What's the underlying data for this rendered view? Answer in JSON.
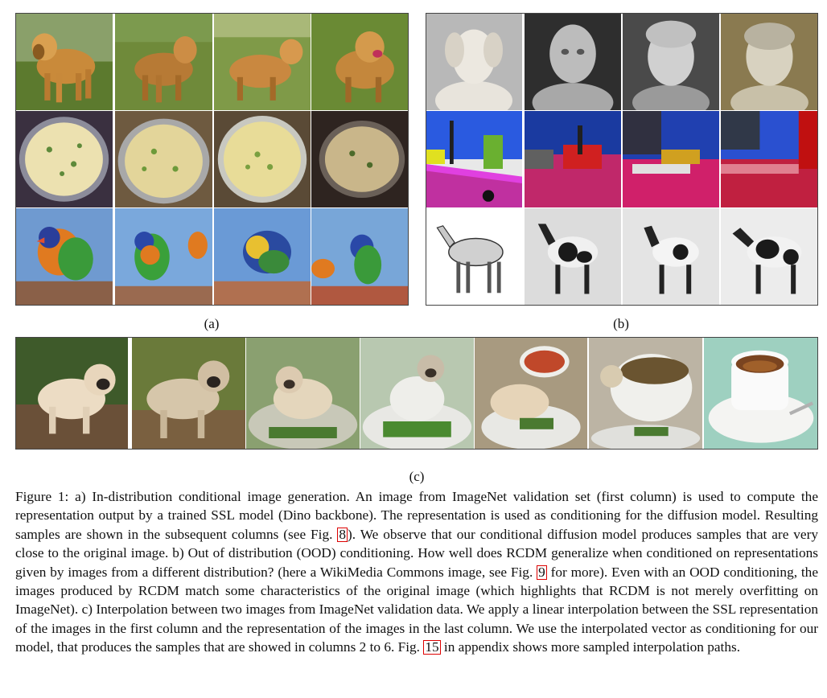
{
  "panels": {
    "a_label": "(a)",
    "b_label": "(b)",
    "c_label": "(c)",
    "a_rows": [
      [
        "golden-retriever",
        "golden-retriever",
        "golden-retriever",
        "golden-retriever"
      ],
      [
        "pasta-salad-bowl",
        "pasta-salad-bowl",
        "pasta-salad-bowl",
        "pasta-salad-bowl"
      ],
      [
        "rainbow-lorikeet",
        "rainbow-lorikeet",
        "rainbow-lorikeet",
        "rainbow-lorikeet"
      ]
    ],
    "b_rows": [
      [
        "marble-bust",
        "marble-bust",
        "marble-bust",
        "marble-bust"
      ],
      [
        "segmentation-map",
        "segmentation-map",
        "segmentation-map",
        "segmentation-map"
      ],
      [
        "horse-sketch",
        "horse-sketch",
        "horse-sketch",
        "horse-sketch"
      ]
    ],
    "c_row": [
      "pug",
      "pug",
      "pug-in-bowl",
      "pug-cup",
      "cup-pug",
      "coffee-cup",
      "espresso-cup"
    ]
  },
  "caption": {
    "p1": "Figure 1: a) In-distribution conditional image generation. An image from ImageNet validation set (first column) is used to compute the representation output by a trained SSL model (Dino backbone). The representation is used as conditioning for the diffusion model. Resulting samples are shown in the subsequent columns (see Fig. ",
    "ref1": "8",
    "p2": "). We observe that our conditional diffusion model produces samples that are very close to the original image. b) Out of distribution (OOD) conditioning. How well does RCDM generalize when conditioned on representations given by images from a different distribution? (here a WikiMedia Commons image, see Fig. ",
    "ref2": "9",
    "p3": " for more). Even with an OOD conditioning, the images produced by RCDM match some characteristics of the original image (which highlights that RCDM is not merely overfitting on ImageNet). c) Interpolation between two images from ImageNet validation data. We apply a linear interpolation between the SSL representation of the images in the first column and the representation of the images in the last column. We use the interpolated vector as conditioning for our model, that produces the samples that are showed in columns 2 to 6. Fig. ",
    "ref3": "15",
    "p4": " in appendix shows more sampled interpolation paths."
  },
  "colors": {
    "reference_box": "#dd0000"
  }
}
